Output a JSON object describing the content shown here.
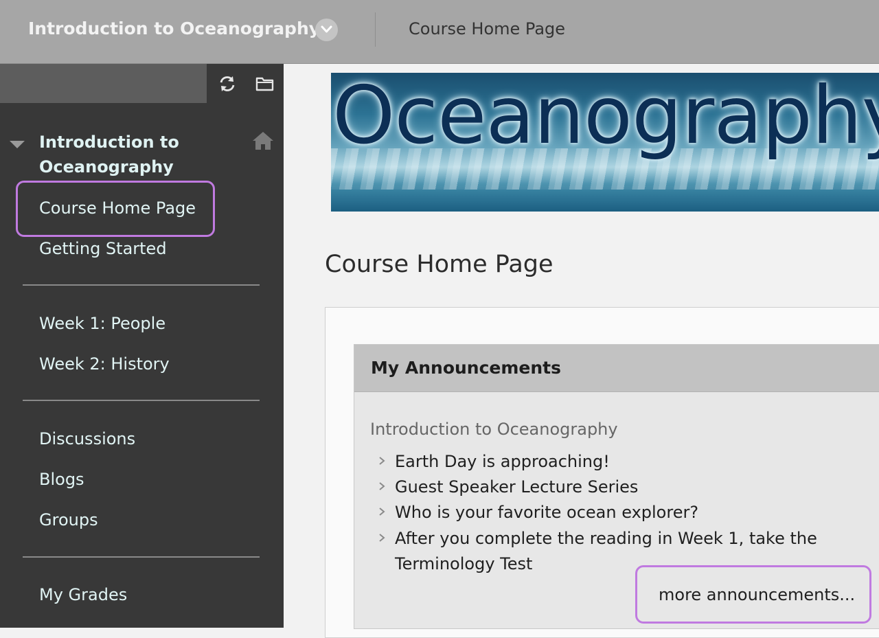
{
  "header": {
    "course_title": "Introduction to Oceanography",
    "breadcrumb": "Course Home Page"
  },
  "sidebar": {
    "course_title": "Introduction to Oceanography",
    "items": [
      {
        "label": "Course Home Page",
        "highlighted": true
      },
      {
        "label": "Getting Started"
      },
      {
        "label": "Week 1: People"
      },
      {
        "label": "Week 2: History"
      },
      {
        "label": "Discussions"
      },
      {
        "label": "Blogs"
      },
      {
        "label": "Groups"
      },
      {
        "label": "My Grades"
      }
    ],
    "icons": [
      "refresh-icon",
      "folder-icon",
      "home-icon",
      "triangle-down-icon"
    ]
  },
  "banner": {
    "text": "Oceanography"
  },
  "main": {
    "page_title": "Course Home Page",
    "module": {
      "title": "My Announcements",
      "course": "Introduction to Oceanography",
      "announcements": [
        "Earth Day is approaching!",
        "Guest Speaker Lecture Series",
        "Who is your favorite ocean explorer?",
        "After you complete the reading in Week 1, take the Terminology Test"
      ],
      "more_link": "more announcements..."
    }
  },
  "colors": {
    "highlight": "#c07ae0",
    "sidebar_bg": "#383838",
    "header_bg": "#a6a6a6"
  }
}
